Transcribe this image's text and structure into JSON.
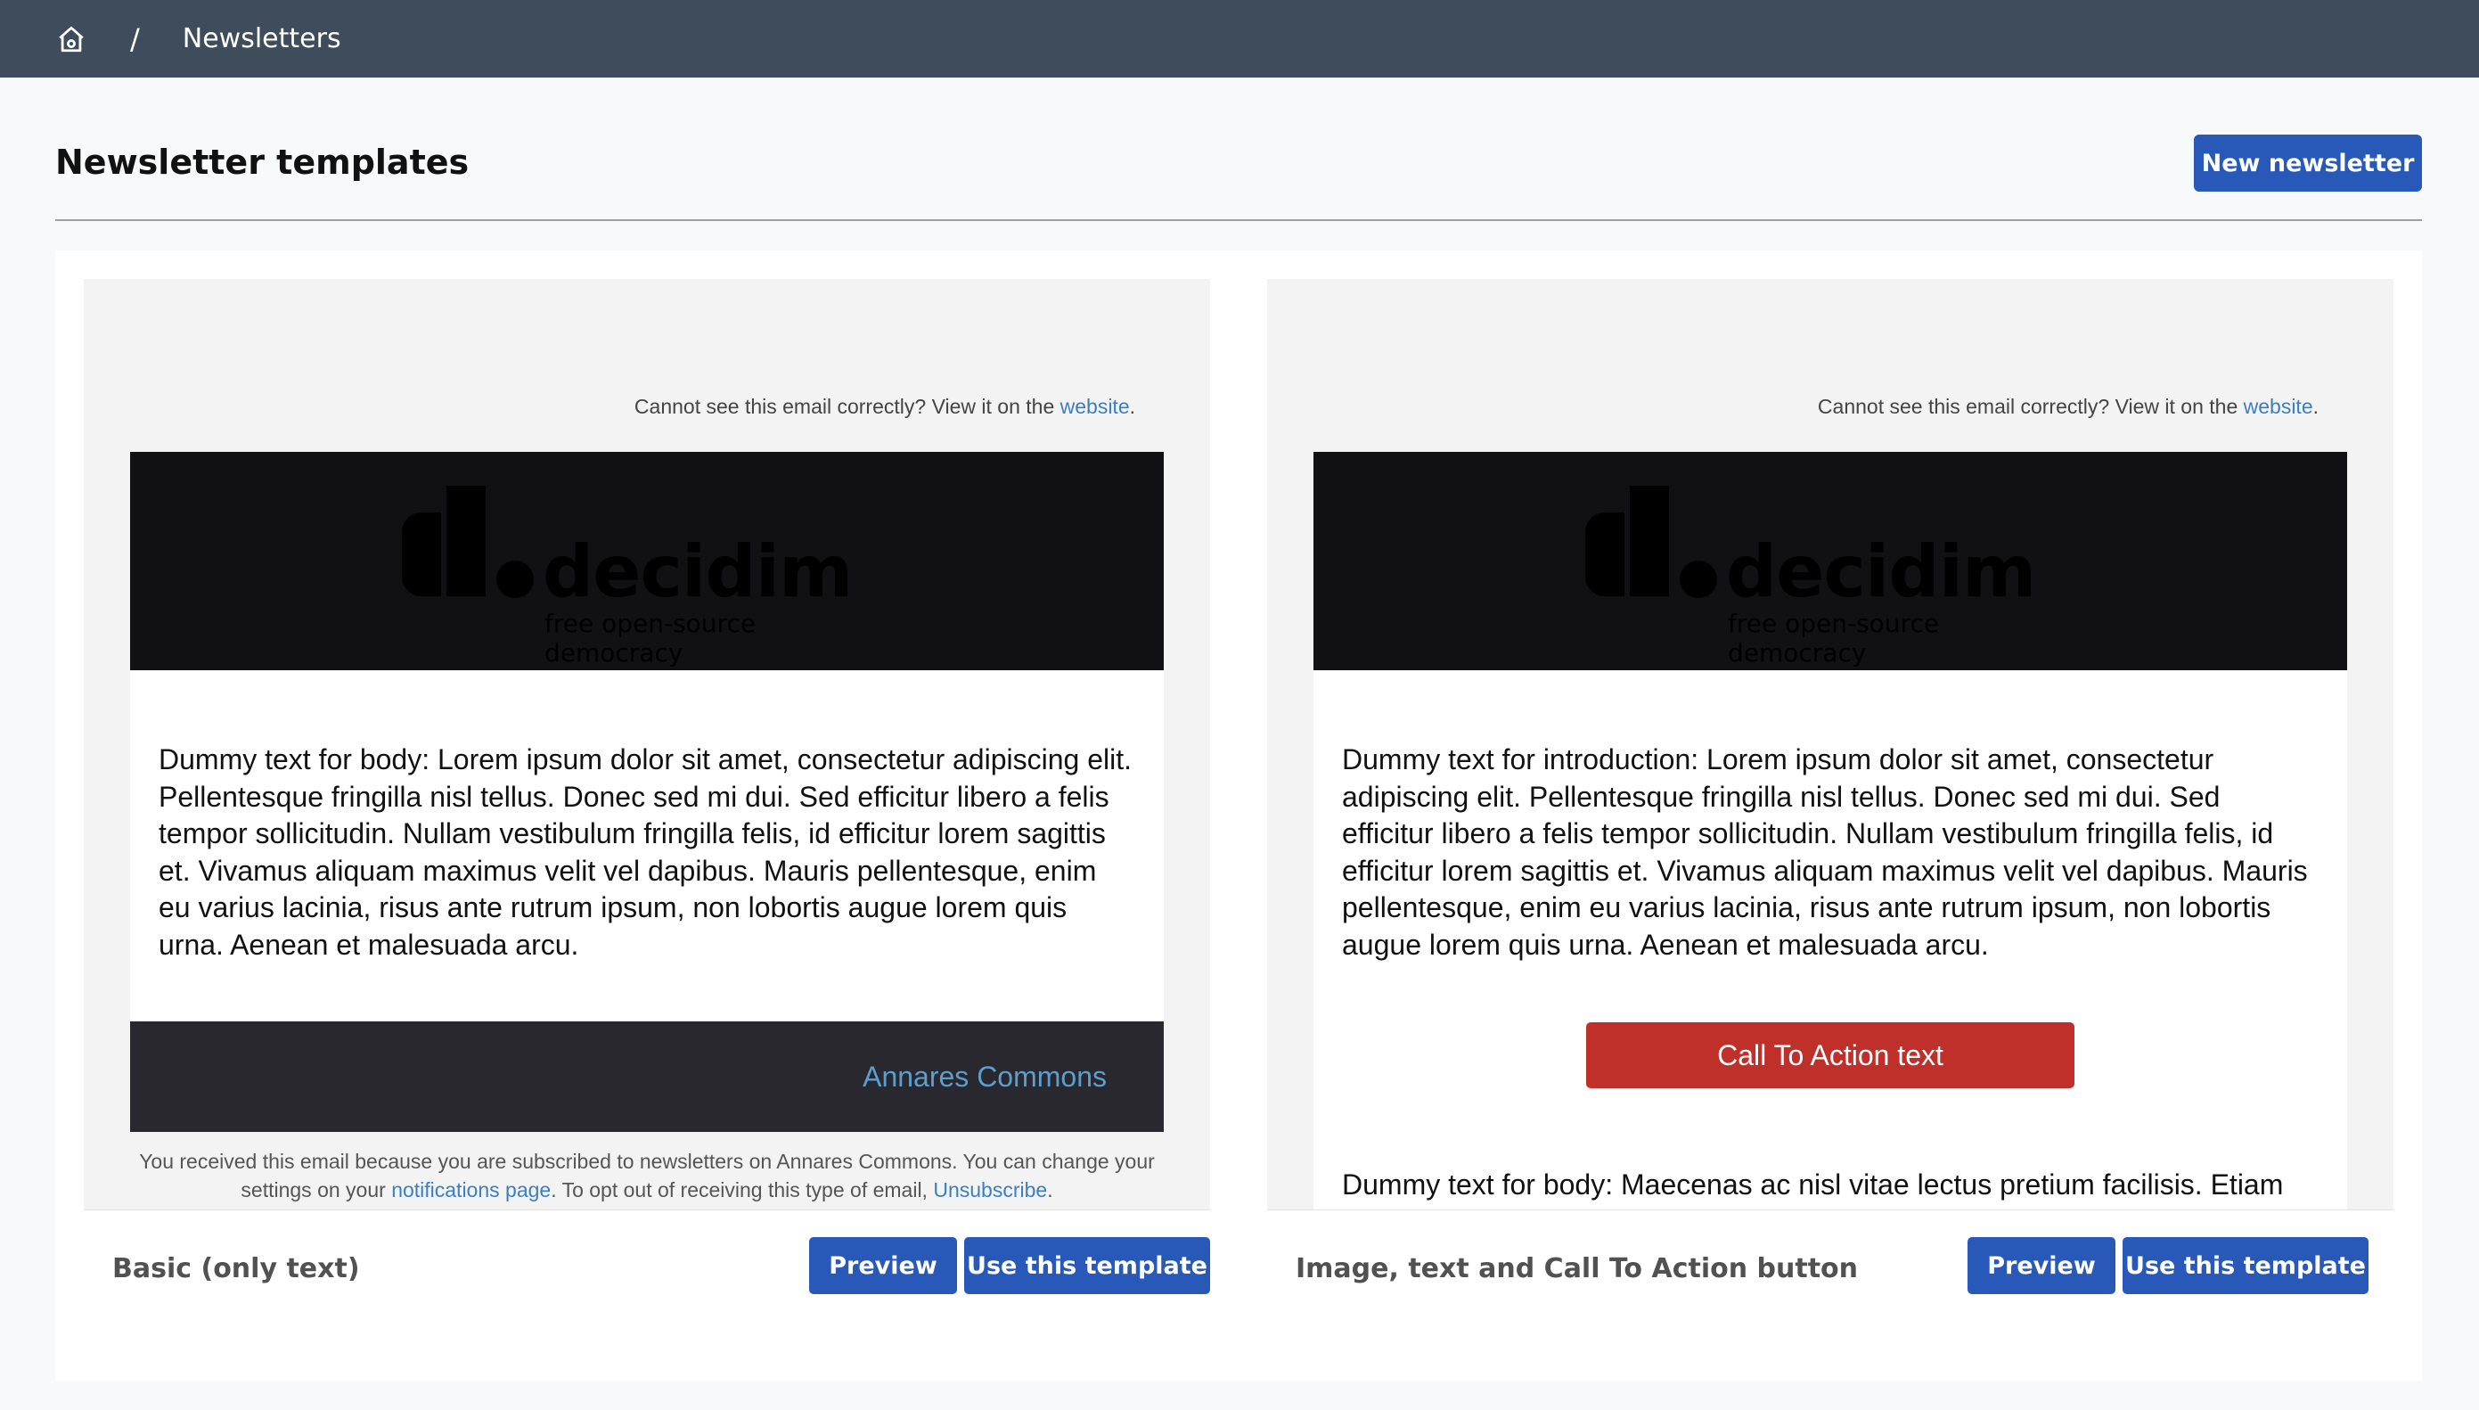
{
  "breadcrumb": {
    "home_icon": "home-icon",
    "separator": "/",
    "current": "Newsletters"
  },
  "header": {
    "title": "Newsletter templates",
    "new_button": "New newsletter"
  },
  "colors": {
    "topbar": "#3e4c5c",
    "primary": "#2859b8",
    "cta": "#c0302a",
    "link": "#3a7fc1"
  },
  "templates": [
    {
      "name": "Basic (only text)",
      "preview_label": "Preview",
      "use_label": "Use this template",
      "view_online_text": "Cannot see this email correctly? View it on the ",
      "view_online_link": "website",
      "view_online_end": ".",
      "logo_word": "decidim",
      "logo_tagline": "free open-source democracy",
      "body": "Dummy text for body: Lorem ipsum dolor sit amet, consectetur adipiscing elit. Pellentesque fringilla nisl tellus. Donec sed mi dui. Sed efficitur libero a felis tempor sollicitudin. Nullam vestibulum fringilla felis, id efficitur lorem sagittis et. Vivamus aliquam maximus velit vel dapibus. Mauris pellentesque, enim eu varius lacinia, risus ante rutrum ipsum, non lobortis augue lorem quis urna. Aenean et malesuada arcu.",
      "footer_org": "Annares Commons",
      "disclaimer_1": "You received this email because you are subscribed to newsletters on Annares Commons. You can change your settings on your ",
      "disclaimer_link_1": "notifications page",
      "disclaimer_2": ". To opt out of receiving this type of email, ",
      "disclaimer_link_2": "Unsubscribe",
      "disclaimer_3": "."
    },
    {
      "name": "Image, text and Call To Action button",
      "preview_label": "Preview",
      "use_label": "Use this template",
      "view_online_text": "Cannot see this email correctly? View it on the ",
      "view_online_link": "website",
      "view_online_end": ".",
      "logo_word": "decidim",
      "logo_tagline": "free open-source democracy",
      "intro": "Dummy text for introduction: Lorem ipsum dolor sit amet, consectetur adipiscing elit. Pellentesque fringilla nisl tellus. Donec sed mi dui. Sed efficitur libero a felis tempor sollicitudin. Nullam vestibulum fringilla felis, id efficitur lorem sagittis et. Vivamus aliquam maximus velit vel dapibus. Mauris pellentesque, enim eu varius lacinia, risus ante rutrum ipsum, non lobortis augue lorem quis urna. Aenean et malesuada arcu.",
      "cta": "Call To Action text",
      "body": "Dummy text for body: Maecenas ac nisl vitae lectus pretium facilisis. Etiam facilisis sem nibh, sit amet rutrum mi aliquam nec. Sed id urna at nisl pretium"
    }
  ]
}
